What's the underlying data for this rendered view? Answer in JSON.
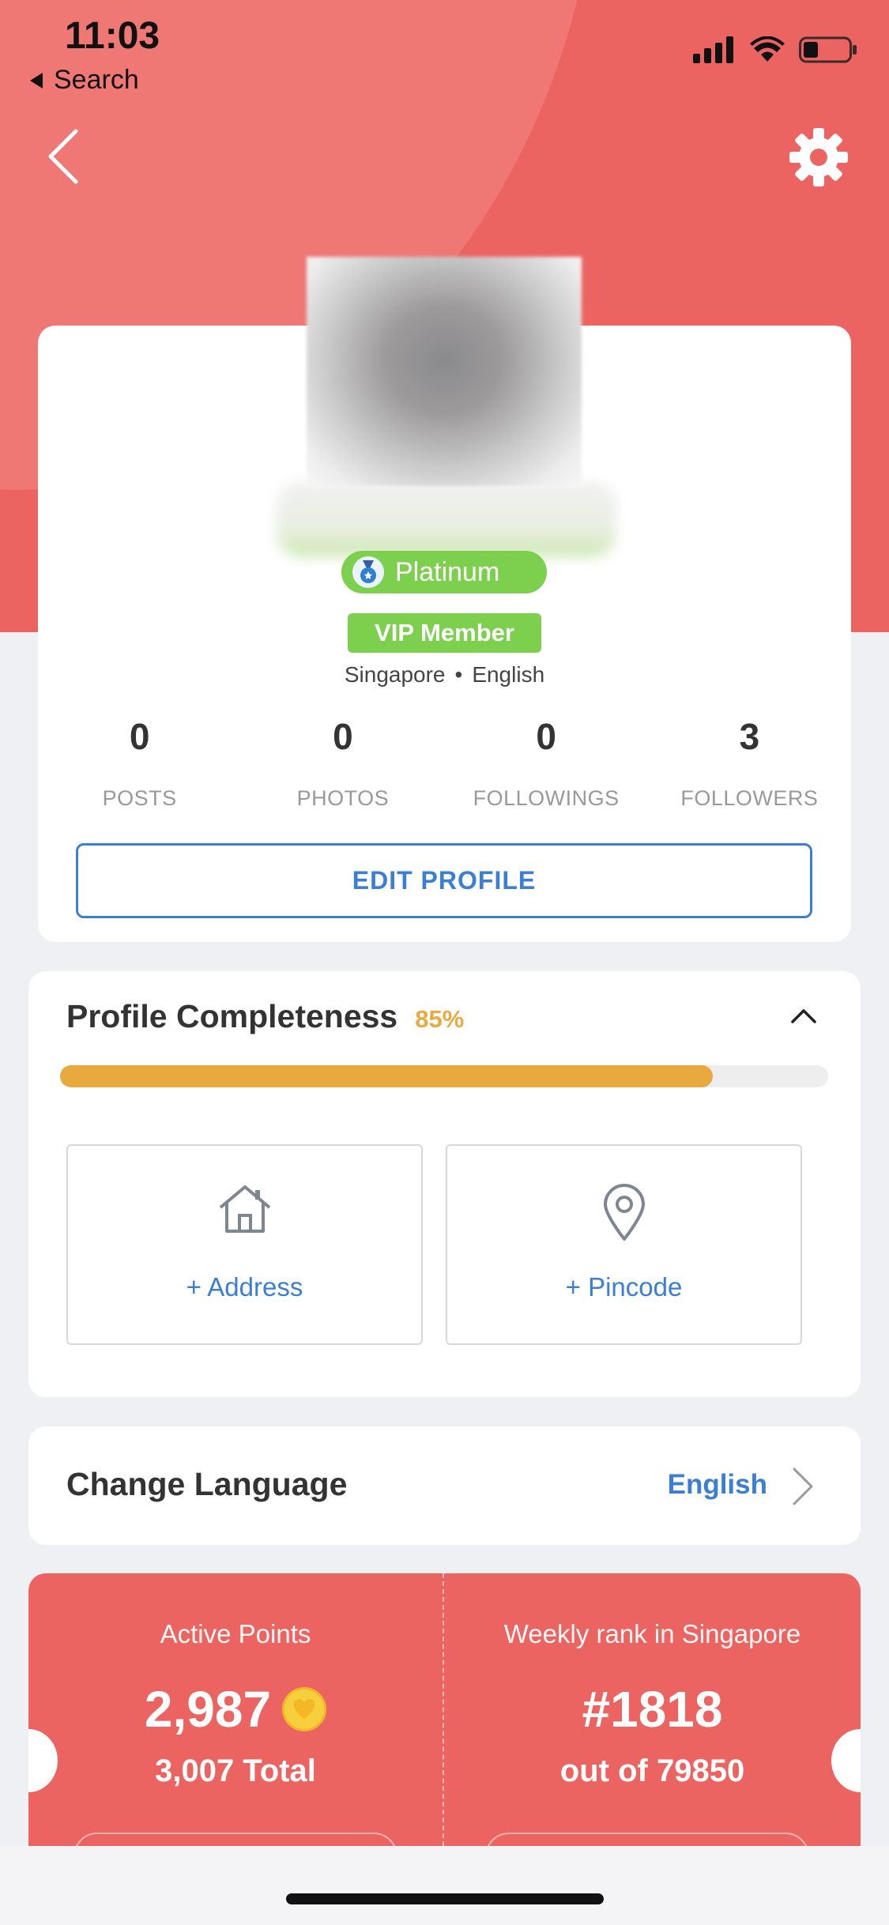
{
  "status_bar": {
    "time": "11:03",
    "back_app_label": "Search"
  },
  "profile": {
    "tier": "Platinum",
    "membership": "VIP Member",
    "country": "Singapore",
    "separator": "•",
    "language": "English",
    "stats": [
      {
        "value": "0",
        "label": "POSTS"
      },
      {
        "value": "0",
        "label": "PHOTOS"
      },
      {
        "value": "0",
        "label": "FOLLOWINGS"
      },
      {
        "value": "3",
        "label": "FOLLOWERS"
      }
    ],
    "edit_button": "EDIT PROFILE"
  },
  "completeness": {
    "title": "Profile Completeness",
    "percent_text": "85%",
    "percent": 85,
    "bar_color": "#e8a93e",
    "tiles": [
      {
        "icon": "home-icon",
        "label": "+ Address"
      },
      {
        "icon": "location-pin-icon",
        "label": "+ Pincode"
      }
    ]
  },
  "language_setting": {
    "title": "Change Language",
    "value": "English"
  },
  "points": {
    "active_label": "Active Points",
    "active_value": "2,987",
    "total_text": "3,007 Total",
    "rank_label": "Weekly rank in Singapore",
    "rank_value": "#1818",
    "rank_out_of": "out of 79850"
  },
  "colors": {
    "brand": "#ec6461",
    "link": "#3b7fd4",
    "badge_green": "#7dd04d"
  }
}
